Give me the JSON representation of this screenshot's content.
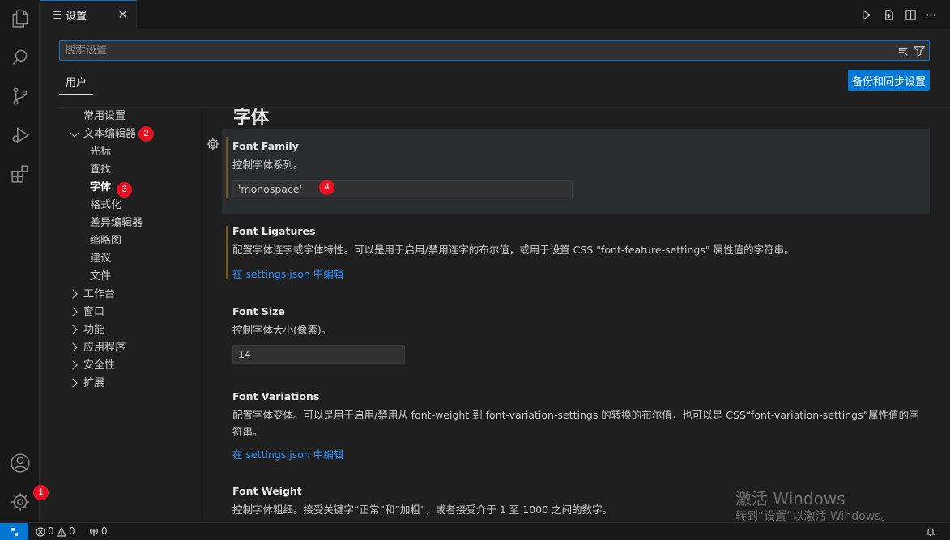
{
  "editor": {
    "tab_label": "设置",
    "close_glyph": "✕"
  },
  "search": {
    "placeholder": "搜索设置"
  },
  "scope": {
    "user_tab": "用户",
    "backup_button": "备份和同步设置"
  },
  "toc": {
    "items": [
      {
        "label": "常用设置"
      },
      {
        "label": "文本编辑器",
        "expanded": true
      },
      {
        "label": "光标"
      },
      {
        "label": "查找"
      },
      {
        "label": "字体",
        "active": true
      },
      {
        "label": "格式化"
      },
      {
        "label": "差异编辑器"
      },
      {
        "label": "缩略图"
      },
      {
        "label": "建议"
      },
      {
        "label": "文件"
      },
      {
        "label": "工作台",
        "expanded": false
      },
      {
        "label": "窗口",
        "expanded": false
      },
      {
        "label": "功能",
        "expanded": false
      },
      {
        "label": "应用程序",
        "expanded": false
      },
      {
        "label": "安全性",
        "expanded": false
      },
      {
        "label": "扩展",
        "expanded": false
      }
    ]
  },
  "content": {
    "section_title": "字体",
    "settings": [
      {
        "title": "Font Family",
        "description": "控制字体系列。",
        "value": "'monospace'",
        "focused": true,
        "modified": true
      },
      {
        "title": "Font Ligatures",
        "description": "配置字体连字或字体特性。可以是用于启用/禁用连字的布尔值，或用于设置 CSS \"font-feature-settings\" 属性值的字符串。",
        "link": "在 settings.json 中编辑",
        "modified": true
      },
      {
        "title": "Font Size",
        "description": "控制字体大小(像素)。",
        "value": "14"
      },
      {
        "title": "Font Variations",
        "description": "配置字体变体。可以是用于启用/禁用从 font-weight 到 font-variation-settings 的转换的布尔值，也可以是 CSS“font-variation-settings”属性值的字符串。",
        "link": "在 settings.json 中编辑"
      },
      {
        "title": "Font Weight",
        "description": "控制字体粗细。接受关键字“正常”和“加粗”，或者接受介于 1 至 1000 之间的数字。"
      }
    ]
  },
  "badges": [
    "1",
    "2",
    "3",
    "4"
  ],
  "watermark": {
    "title": "激活 Windows",
    "subtitle": "转到“设置”以激活 Windows。"
  },
  "status_bar": {
    "errors": "0",
    "warnings": "0",
    "ports": "0"
  },
  "colors": {
    "accent": "#0078d4",
    "badge": "#e81123",
    "link": "#3794ff",
    "modified_indicator": "#73591a"
  }
}
